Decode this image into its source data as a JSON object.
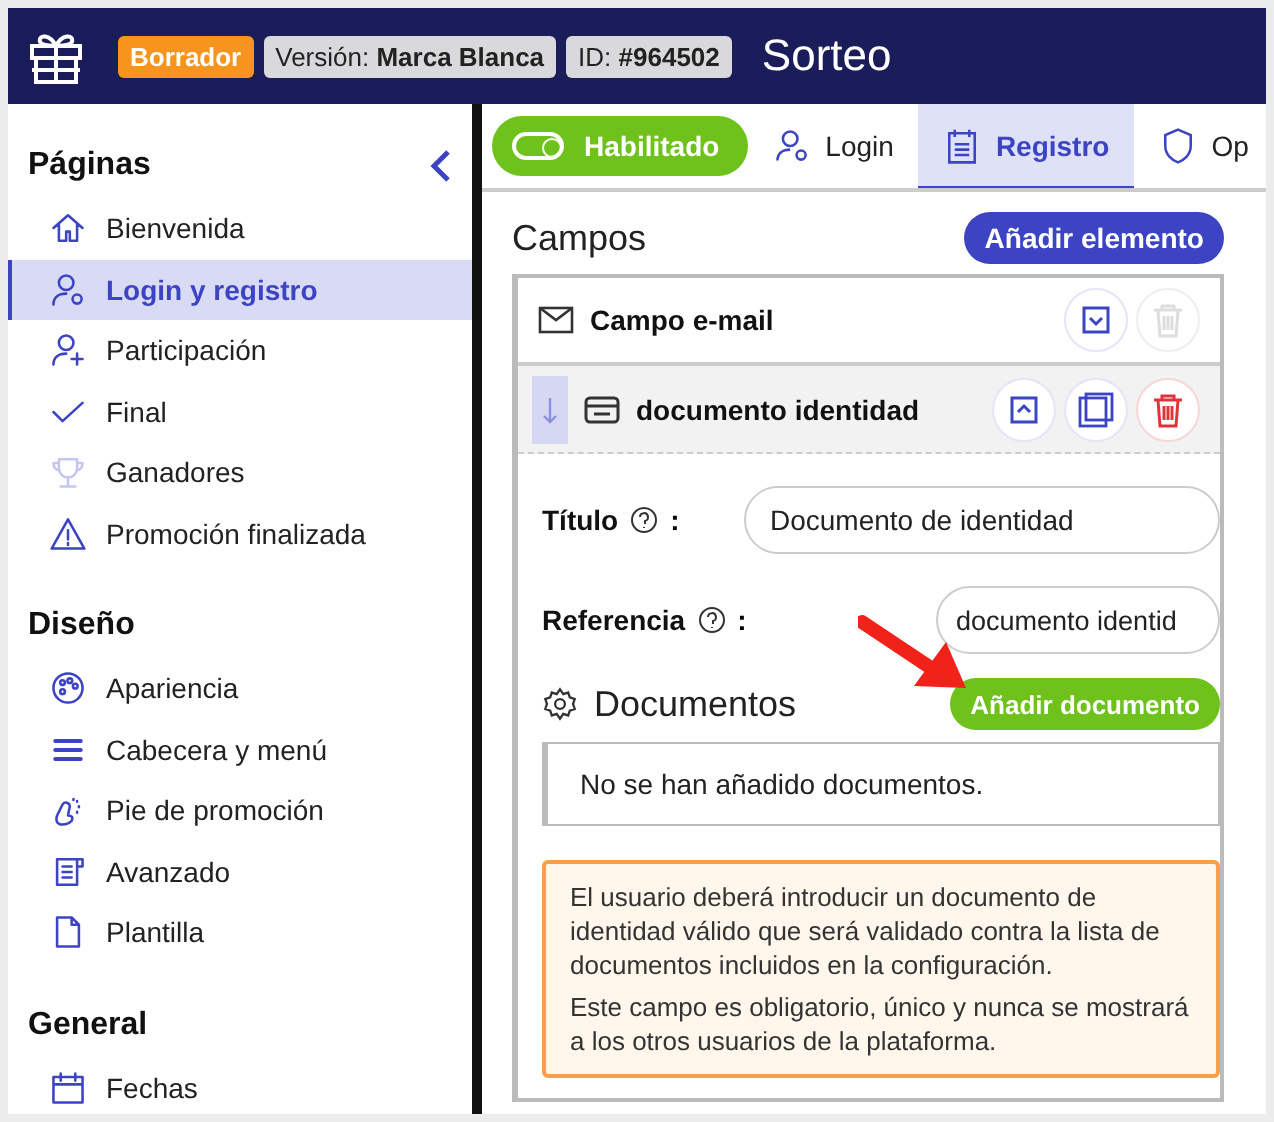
{
  "header": {
    "status_badge": "Borrador",
    "version_label": "Versión:",
    "version_value": "Marca Blanca",
    "id_label": "ID:",
    "id_value": "#964502",
    "title": "Sorteo"
  },
  "sidebar": {
    "sections": [
      {
        "title": "Páginas",
        "items": [
          {
            "label": "Bienvenida",
            "selected": false
          },
          {
            "label": "Login y registro",
            "selected": true
          },
          {
            "label": "Participación",
            "selected": false
          },
          {
            "label": "Final",
            "selected": false
          },
          {
            "label": "Ganadores",
            "selected": false
          },
          {
            "label": "Promoción finalizada",
            "selected": false
          }
        ]
      },
      {
        "title": "Diseño",
        "items": [
          {
            "label": "Apariencia",
            "selected": false
          },
          {
            "label": "Cabecera y menú",
            "selected": false
          },
          {
            "label": "Pie de promoción",
            "selected": false
          },
          {
            "label": "Avanzado",
            "selected": false
          },
          {
            "label": "Plantilla",
            "selected": false
          }
        ]
      },
      {
        "title": "General",
        "items": [
          {
            "label": "Fechas",
            "selected": false
          }
        ]
      }
    ]
  },
  "toggle": {
    "label": "Habilitado",
    "on": true
  },
  "tabs": [
    {
      "label": "Login",
      "selected": false
    },
    {
      "label": "Registro",
      "selected": true
    },
    {
      "label": "Op",
      "selected": false
    }
  ],
  "fields_section": {
    "title": "Campos",
    "add_button": "Añadir elemento",
    "fields": [
      {
        "label": "Campo e-mail",
        "expanded": false,
        "delete_enabled": false
      },
      {
        "label": "documento identidad",
        "expanded": true,
        "delete_enabled": true,
        "form": [
          {
            "label": "Título",
            "separator": ":",
            "value": "Documento de identidad"
          },
          {
            "label": "Referencia",
            "separator": ":",
            "value": "documento identid"
          }
        ],
        "documents": {
          "title": "Documentos",
          "add_button": "Añadir documento",
          "empty_message": "No se han añadido documentos."
        },
        "info": [
          "El usuario deberá introducir un documento de identidad válido que será validado contra la lista de documentos incluidos en la configuración.",
          "Este campo es obligatorio, único y nunca se mostrará a los otros usuarios de la plataforma."
        ]
      }
    ]
  }
}
